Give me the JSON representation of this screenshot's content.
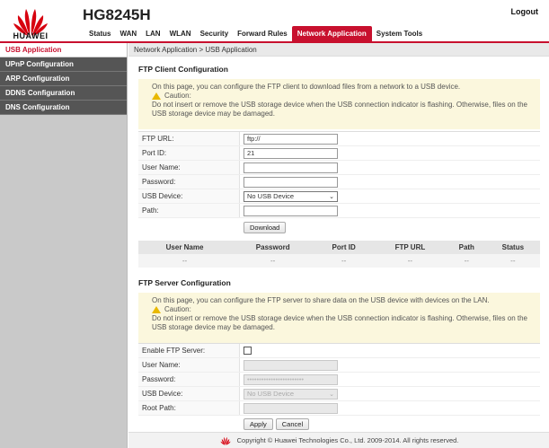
{
  "header": {
    "brand": "HUAWEI",
    "model": "HG8245H",
    "logout": "Logout",
    "nav": [
      "Status",
      "WAN",
      "LAN",
      "WLAN",
      "Security",
      "Forward Rules",
      "Network Application",
      "System Tools"
    ],
    "active_nav": "Network Application",
    "accent": "#c8102e"
  },
  "sidebar": {
    "items": [
      "USB Application",
      "UPnP Configuration",
      "ARP Configuration",
      "DDNS Configuration",
      "DNS Configuration"
    ],
    "active": "USB Application"
  },
  "breadcrumb": "Network Application > USB Application",
  "ftp_client": {
    "title": "FTP Client Configuration",
    "notice": "On this page, you can configure the FTP client to download files from a network to a USB device.",
    "caution_label": "Caution:",
    "caution_text": "Do not insert or remove the USB storage device when the USB connection indicator is flashing. Otherwise, files on the USB storage device may be damaged.",
    "fields": {
      "ftp_url": {
        "label": "FTP URL:",
        "value": "ftp://"
      },
      "port_id": {
        "label": "Port ID:",
        "value": "21"
      },
      "user_name": {
        "label": "User Name:",
        "value": ""
      },
      "password": {
        "label": "Password:",
        "value": ""
      },
      "usb_device": {
        "label": "USB Device:",
        "value": "No USB Device"
      },
      "path": {
        "label": "Path:",
        "value": ""
      }
    },
    "download_button": "Download",
    "table": {
      "headers": [
        "User Name",
        "Password",
        "Port ID",
        "FTP URL",
        "Path",
        "Status"
      ],
      "row": [
        "--",
        "--",
        "--",
        "--",
        "--",
        "--"
      ]
    }
  },
  "ftp_server": {
    "title": "FTP Server Configuration",
    "notice": "On this page, you can configure the FTP server to share data on the USB device with devices on the LAN.",
    "caution_label": "Caution:",
    "caution_text": "Do not insert or remove the USB storage device when the USB connection indicator is flashing. Otherwise, files on the USB storage device may be damaged.",
    "fields": {
      "enable": {
        "label": "Enable FTP Server:",
        "checked": false
      },
      "user_name": {
        "label": "User Name:",
        "value": ""
      },
      "password": {
        "label": "Password:",
        "value": "••••••••••••••••••••••••"
      },
      "usb_device": {
        "label": "USB Device:",
        "value": "No USB Device"
      },
      "root_path": {
        "label": "Root Path:",
        "value": ""
      }
    },
    "apply_button": "Apply",
    "cancel_button": "Cancel"
  },
  "footer": {
    "copyright": "Copyright © Huawei Technologies Co., Ltd. 2009-2014. All rights reserved."
  }
}
